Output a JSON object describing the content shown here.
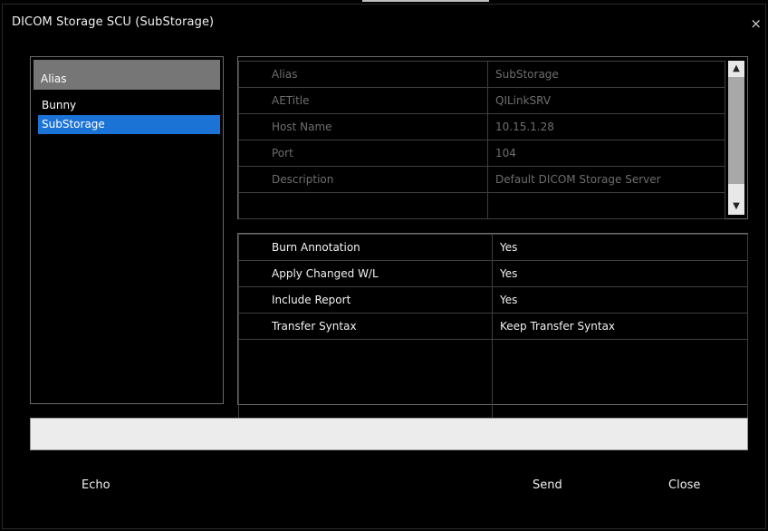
{
  "window": {
    "title": "DICOM Storage SCU (SubStorage)",
    "close_glyph": "×"
  },
  "alias_list": {
    "header": "Alias",
    "items": [
      {
        "label": "Bunny",
        "selected": false
      },
      {
        "label": "SubStorage",
        "selected": true
      }
    ]
  },
  "server_info": {
    "rows": [
      {
        "field": "Alias",
        "value": "SubStorage"
      },
      {
        "field": "AETitle",
        "value": "QILinkSRV"
      },
      {
        "field": "Host Name",
        "value": "10.15.1.28"
      },
      {
        "field": "Port",
        "value": "104"
      },
      {
        "field": "Description",
        "value": "Default DICOM Storage Server"
      },
      {
        "field": "",
        "value": ""
      }
    ],
    "scroll_up_glyph": "▲",
    "scroll_down_glyph": "▼"
  },
  "settings": {
    "rows": [
      {
        "field": "Burn Annotation",
        "value": "Yes"
      },
      {
        "field": "Apply Changed W/L",
        "value": "Yes"
      },
      {
        "field": "Include Report",
        "value": "Yes"
      },
      {
        "field": "Transfer Syntax",
        "value": "Keep Transfer Syntax"
      }
    ]
  },
  "footer": {
    "echo_label": "Echo",
    "send_label": "Send",
    "close_label": "Close"
  },
  "colors": {
    "selection": "#1c73d6",
    "header_bg": "#767676",
    "disabled_text": "#6e6e6e"
  }
}
